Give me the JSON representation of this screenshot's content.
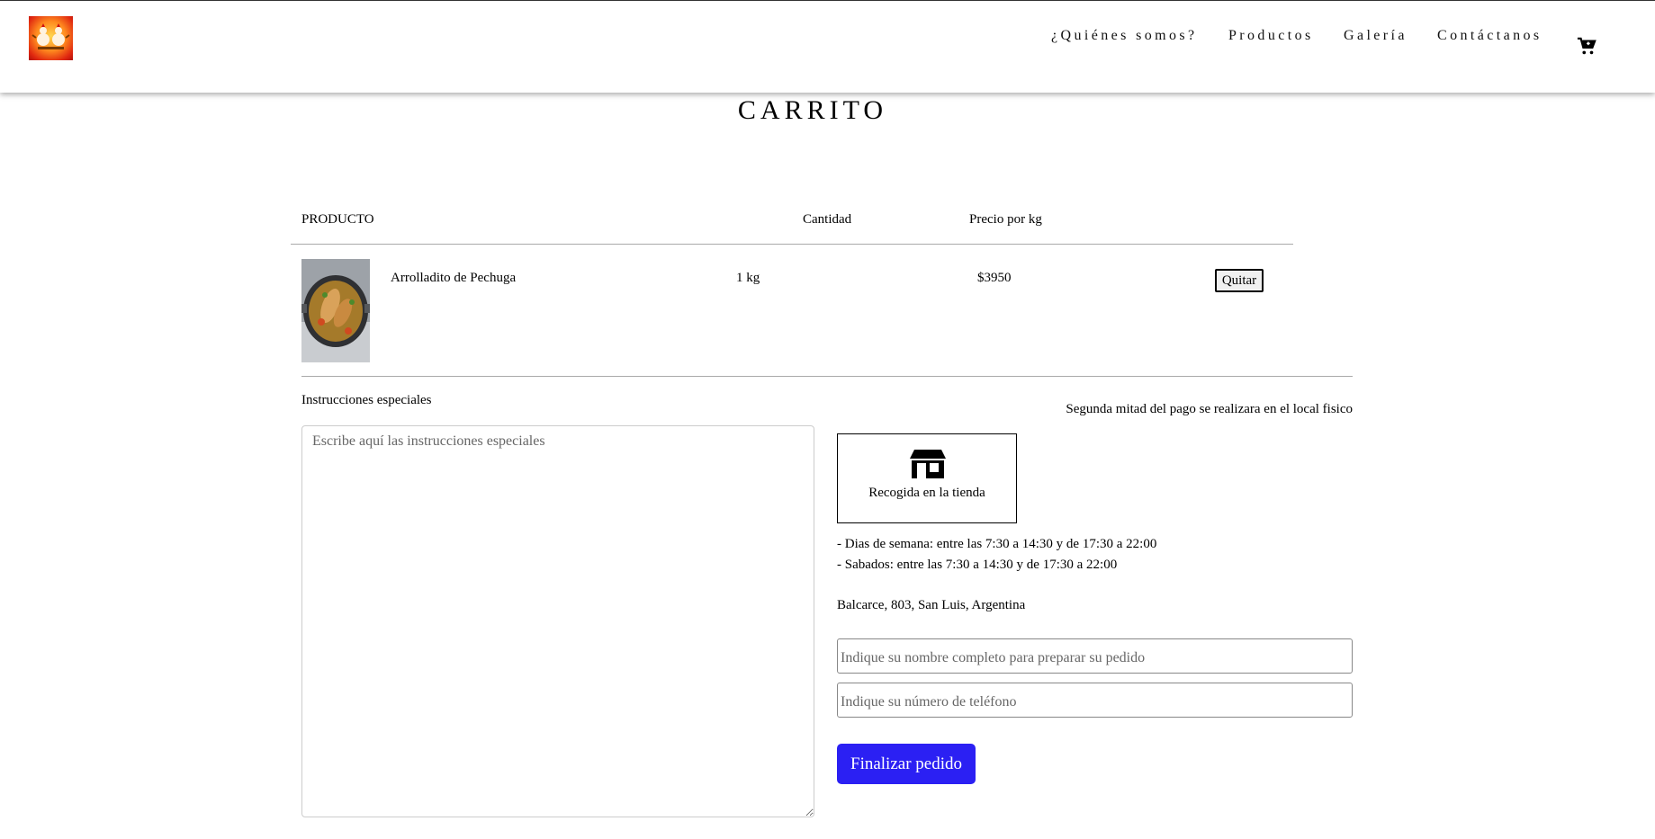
{
  "header": {
    "logo_alt": "chicken-logo",
    "nav": [
      "¿Quiénes somos?",
      "Productos",
      "Galería",
      "Contáctanos"
    ],
    "cart_icon": "cart-icon"
  },
  "page": {
    "title": "CARRITO"
  },
  "table": {
    "headers": {
      "product": "PRODUCTO",
      "quantity": "Cantidad",
      "price": "Precio por kg"
    },
    "items": [
      {
        "name": "Arrolladito de Pechuga",
        "quantity": "1 kg",
        "price": "$3950",
        "remove_label": "Quitar",
        "image_icon": "food-photo"
      }
    ]
  },
  "instructions": {
    "label": "Instrucciones especiales",
    "placeholder": "Escribe aquí las instrucciones especiales"
  },
  "payment": {
    "note": "Segunda mitad del pago se realizara en el local fisico"
  },
  "pickup": {
    "label": "Recogida en la tienda",
    "icon": "store-icon",
    "hours": [
      "- Dias de semana: entre las 7:30 a 14:30 y de 17:30 a 22:00",
      "- Sabados: entre las 7:30 a 14:30 y de 17:30 a 22:00"
    ],
    "address": "Balcarce, 803, San Luis, Argentina"
  },
  "form": {
    "name_placeholder": "Indique su nombre completo para preparar su pedido",
    "phone_placeholder": "Indique su número de teléfono",
    "submit_label": "Finalizar pedido"
  },
  "colors": {
    "accent": "#2b20f3"
  }
}
